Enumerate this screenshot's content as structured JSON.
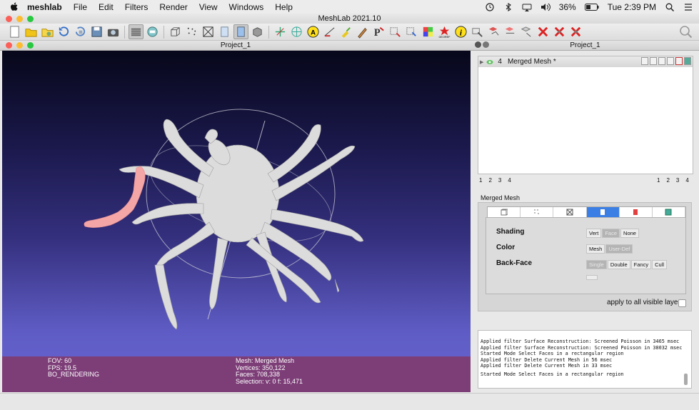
{
  "menubar": {
    "app_name": "meshlab",
    "items": [
      "File",
      "Edit",
      "Filters",
      "Render",
      "View",
      "Windows",
      "Help"
    ],
    "battery": "36%",
    "clock": "Tue 2:39 PM"
  },
  "window": {
    "title": "MeshLab 2021.10"
  },
  "viewer": {
    "title": "Project_1"
  },
  "panel": {
    "title": "Project_1"
  },
  "layers": [
    {
      "index": "4",
      "name": "Merged Mesh *"
    }
  ],
  "layer_pages_left": [
    "1",
    "2",
    "3",
    "4"
  ],
  "layer_pages_right": [
    "1",
    "2",
    "3",
    "4"
  ],
  "render_panel": {
    "mesh_name": "Merged Mesh",
    "shading_label": "Shading",
    "shading_options": [
      "Vert",
      "Face",
      "None"
    ],
    "color_label": "Color",
    "color_options": [
      "Mesh",
      "User-Def"
    ],
    "backface_label": "Back-Face",
    "backface_options": [
      "Single",
      "Double",
      "Fancy",
      "Cull"
    ],
    "apply_label": "apply to all visible layers"
  },
  "viewport_info": {
    "fov": "FOV: 60",
    "fps": "FPS:   19.5",
    "render_mode": "BO_RENDERING",
    "mesh": "Mesh: Merged Mesh",
    "vertices": "Vertices: 350,122",
    "faces": "Faces: 708,338",
    "selection": "Selection: v: 0 f: 15,471"
  },
  "log_lines": [
    "Applied filter Surface Reconstruction: Screened Poisson in 3465 msec",
    "Applied filter Surface Reconstruction: Screened Poisson in 38032 msec",
    "Started Mode Select Faces in a rectangular region",
    "Applied filter Delete Current Mesh in 56 msec",
    "Applied filter Delete Current Mesh in 33 msec",
    "",
    "Started Mode Select Faces in a rectangular region"
  ],
  "toolbar_icons": [
    "new-project",
    "open-project",
    "open-mesh",
    "reload",
    "reload-all",
    "save",
    "snapshot",
    "layers",
    "raster",
    "bbox",
    "points",
    "wireframe",
    "flat",
    "smooth",
    "cube-view",
    "axes",
    "sphere",
    "annotation",
    "measure",
    "paint-brush",
    "pencil",
    "pickpoint",
    "select-vertices",
    "select-faces",
    "color-picker",
    "georef",
    "info",
    "select-connected",
    "align",
    "manipulator",
    "move",
    "delete-vertices",
    "delete-faces",
    "delete-all"
  ],
  "colors": {
    "selection_highlight": "#f4a6a6",
    "info_bar": "#7d3e78",
    "mesh": "#e0e0e0",
    "active_tab": "#3b7fe5"
  }
}
